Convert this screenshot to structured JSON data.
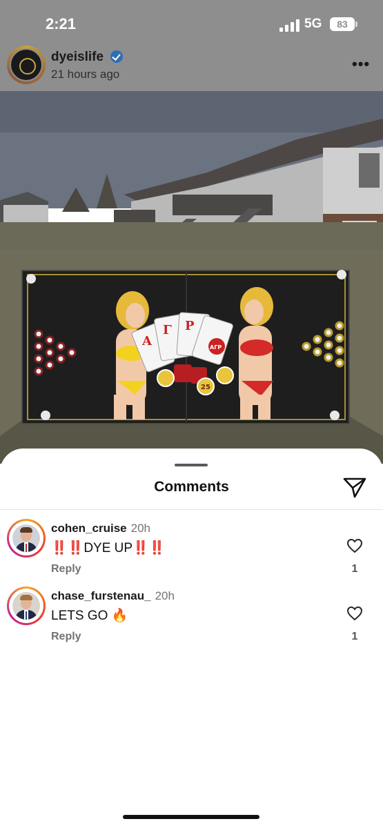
{
  "status_bar": {
    "time": "2:21",
    "network": "5G",
    "battery": "83"
  },
  "post": {
    "username": "dyeislife",
    "time_ago": "21 hours ago",
    "more_icon": "more-horizontal-icon",
    "verified_icon": "verified-badge-icon"
  },
  "photo": {
    "card_letters": [
      "Α",
      "Γ",
      "Ρ"
    ],
    "card_label": "ΑΓΡ",
    "chip_label": "25"
  },
  "comments_sheet": {
    "title": "Comments",
    "share_icon": "send-icon",
    "items": [
      {
        "username": "cohen_cruise",
        "time": "20h",
        "text_parts": [
          "‼️‼️",
          "DYE UP",
          "‼️‼️"
        ],
        "reply_label": "Reply",
        "like_count": "1"
      },
      {
        "username": "chase_furstenau_",
        "time": "20h",
        "text_parts": [
          "LETS GO ",
          "🔥"
        ],
        "reply_label": "Reply",
        "like_count": "1"
      }
    ]
  },
  "colors": {
    "dim_overlay": "#8e8e8e",
    "verified_blue": "#2f6fb3",
    "accent_red": "#e0272d",
    "muted_text": "#737373"
  }
}
